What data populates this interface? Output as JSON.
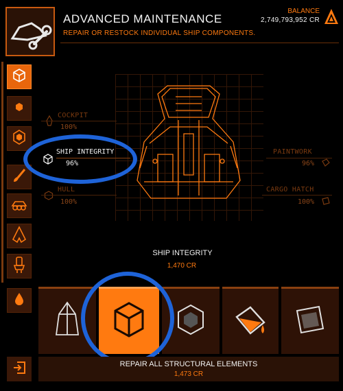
{
  "header": {
    "title": "ADVANCED MAINTENANCE",
    "subtitle": "REPAIR OR RESTOCK INDIVIDUAL SHIP COMPONENTS.",
    "balance_label": "BALANCE",
    "balance_value": "2,749,793,952 CR"
  },
  "components": {
    "cockpit": {
      "label": "COCKPIT",
      "pct": "100%"
    },
    "ship_integrity": {
      "label": "SHIP INTEGRITY",
      "pct": "96%"
    },
    "hull": {
      "label": "HULL",
      "pct": "100%"
    },
    "paintwork": {
      "label": "PAINTWORK",
      "pct": "96%"
    },
    "cargo_hatch": {
      "label": "CARGO HATCH",
      "pct": "100%"
    }
  },
  "selected": {
    "name": "SHIP INTEGRITY",
    "cost": "1,470 CR"
  },
  "repair_all": {
    "label": "REPAIR ALL STRUCTURAL ELEMENTS",
    "cost": "1,473 CR"
  },
  "sidebar": {
    "items": [
      {
        "icon": "cube-icon",
        "active": true
      },
      {
        "icon": "hexagon-small-icon",
        "active": false
      },
      {
        "icon": "hexagon-icon",
        "active": false
      },
      {
        "icon": "paint-brush-icon",
        "active": false
      },
      {
        "icon": "srv-vehicle-icon",
        "active": false
      },
      {
        "icon": "ship-outline-icon",
        "active": false
      },
      {
        "icon": "thruster-icon",
        "active": false
      },
      {
        "icon": "fuel-drop-icon",
        "active": false
      }
    ]
  },
  "tiles": [
    {
      "icon": "cockpit-canopy-icon",
      "active": false
    },
    {
      "icon": "cube-icon",
      "active": true
    },
    {
      "icon": "hexagon-icon",
      "active": false
    },
    {
      "icon": "paint-bucket-icon",
      "active": false
    },
    {
      "icon": "cargo-hatch-icon",
      "active": false
    }
  ],
  "colors": {
    "accent": "#ff7a10",
    "highlight_ring": "#1e63d8",
    "background": "#000000"
  }
}
